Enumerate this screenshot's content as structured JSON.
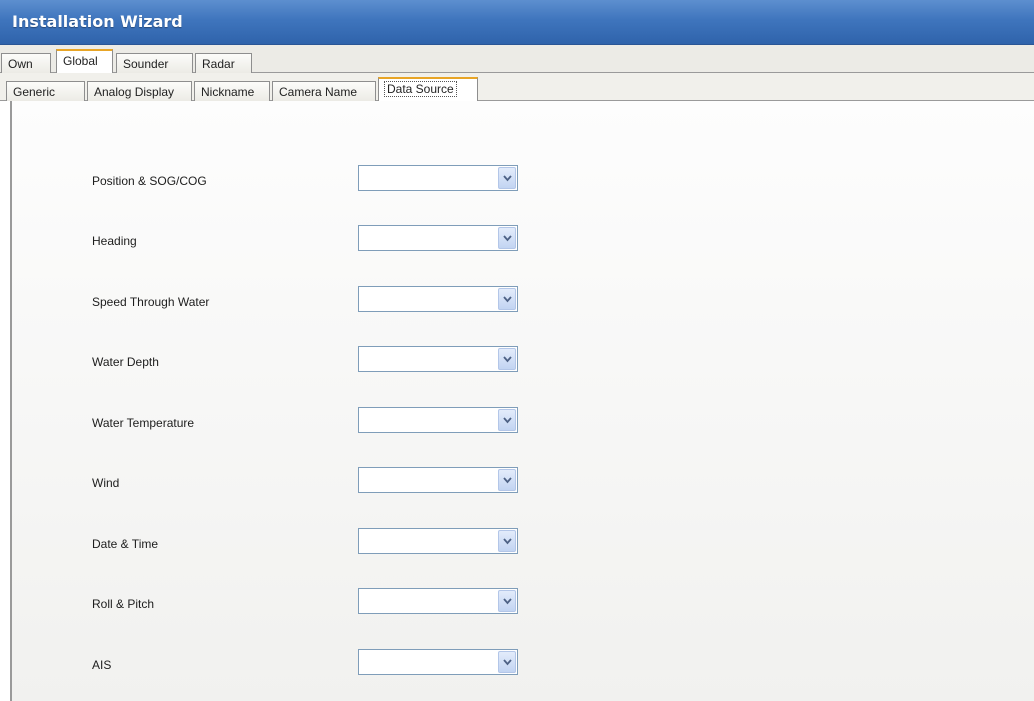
{
  "window": {
    "title": "Installation Wizard"
  },
  "top_tabs": [
    {
      "label": "Own",
      "active": false
    },
    {
      "label": "Global",
      "active": true
    },
    {
      "label": "Sounder",
      "active": false
    },
    {
      "label": "Radar",
      "active": false
    }
  ],
  "sub_tabs": [
    {
      "label": "Generic",
      "active": false
    },
    {
      "label": "Analog Display",
      "active": false
    },
    {
      "label": "Nickname",
      "active": false
    },
    {
      "label": "Camera Name",
      "active": false
    },
    {
      "label": "Data Source",
      "active": true
    }
  ],
  "data_source": {
    "rows": [
      {
        "label": "Position & SOG/COG",
        "value": ""
      },
      {
        "label": "Heading",
        "value": ""
      },
      {
        "label": "Speed Through Water",
        "value": ""
      },
      {
        "label": "Water Depth",
        "value": ""
      },
      {
        "label": "Water Temperature",
        "value": ""
      },
      {
        "label": "Wind",
        "value": ""
      },
      {
        "label": "Date & Time",
        "value": ""
      },
      {
        "label": "Roll & Pitch",
        "value": ""
      },
      {
        "label": "AIS",
        "value": ""
      }
    ]
  },
  "colors": {
    "titlebar": "#3f75bd",
    "active_tab_accent": "#e8a526",
    "combo_border": "#7f9db9",
    "combo_arrow": "#4d6185"
  },
  "icons": {
    "combo_button": "chevron-down-icon"
  }
}
